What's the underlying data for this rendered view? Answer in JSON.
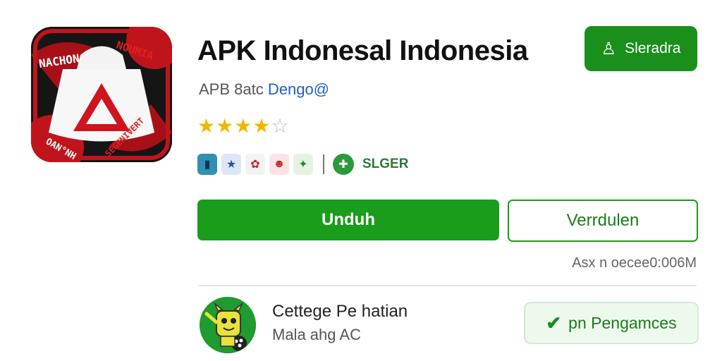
{
  "app": {
    "title": "APK Indonesal Indonesia",
    "subtitle_prefix": "APB 8atc",
    "developer_link": "Dengo@",
    "rating_stars": 4,
    "rating_max": 5,
    "icon_texts": {
      "top_left": "NACHON",
      "top_right": "NOUMIA",
      "bottom_left": "OAN°NH",
      "bottom_right": "SEGENIVERT"
    }
  },
  "badges": {
    "icons": [
      "tablet-icon",
      "star-person-icon",
      "flower-icon",
      "character-icon",
      "leaf-icon"
    ],
    "age_label": "SLGER",
    "gamepad_icon": "gamepad-icon"
  },
  "header_button": {
    "label": "Sleradra",
    "icon": "person-icon"
  },
  "actions": {
    "download_label": "Unduh",
    "secondary_label": "Verrdulen"
  },
  "size_info": "Asx n oecee0:006M",
  "developer": {
    "name": "Cettege Pe hatian",
    "sub": "Mala ahg AC"
  },
  "security_button": {
    "label": "pn Pengamces",
    "icon": "check-icon"
  },
  "colors": {
    "primary_green": "#1a9d1a",
    "star_gold": "#f2b600",
    "link_blue": "#1f5fbf",
    "icon_red": "#d0141e"
  }
}
